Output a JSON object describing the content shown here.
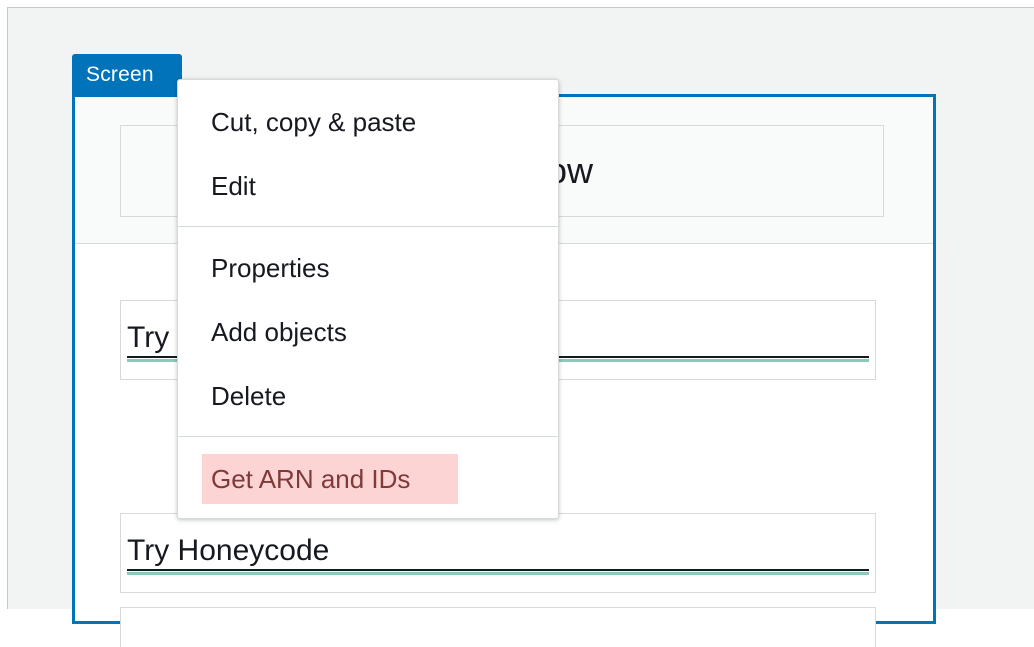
{
  "screen": {
    "tab_label": "Screen",
    "header_title": "Row"
  },
  "content": {
    "first_link_text": "Try",
    "second_link_text": "Try Honeycode"
  },
  "context_menu": {
    "items": [
      {
        "label": "Cut, copy & paste"
      },
      {
        "label": "Edit"
      },
      {
        "label": "Properties"
      },
      {
        "label": "Add objects"
      },
      {
        "label": "Delete"
      },
      {
        "label": "Get ARN and IDs",
        "highlighted": true
      }
    ]
  },
  "colors": {
    "accent": "#0073bb",
    "highlight_bg": "#fdd4d4",
    "link_underline": "#8fc7b8"
  }
}
